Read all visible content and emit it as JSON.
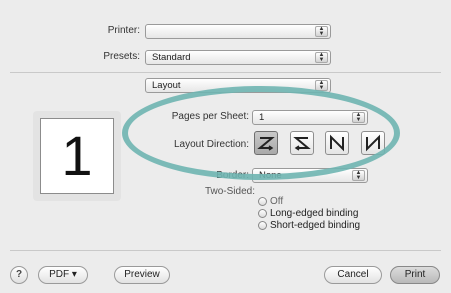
{
  "printer": {
    "label": "Printer:",
    "value": ""
  },
  "presets": {
    "label": "Presets:",
    "value": "Standard"
  },
  "panel": {
    "value": "Layout"
  },
  "preview": {
    "page_number": "1"
  },
  "layout": {
    "pages_per_sheet_label": "Pages per Sheet:",
    "pages_per_sheet_value": "1",
    "direction_label": "Layout Direction:",
    "border_label": "Border:",
    "border_value": "None",
    "two_sided_label": "Two-Sided:",
    "two_sided_options": [
      "Off",
      "Long-edged binding",
      "Short-edged binding"
    ]
  },
  "buttons": {
    "help": "?",
    "pdf": "PDF ▾",
    "preview": "Preview",
    "cancel": "Cancel",
    "print": "Print"
  },
  "colors": {
    "highlight": "#6fb5b1"
  }
}
